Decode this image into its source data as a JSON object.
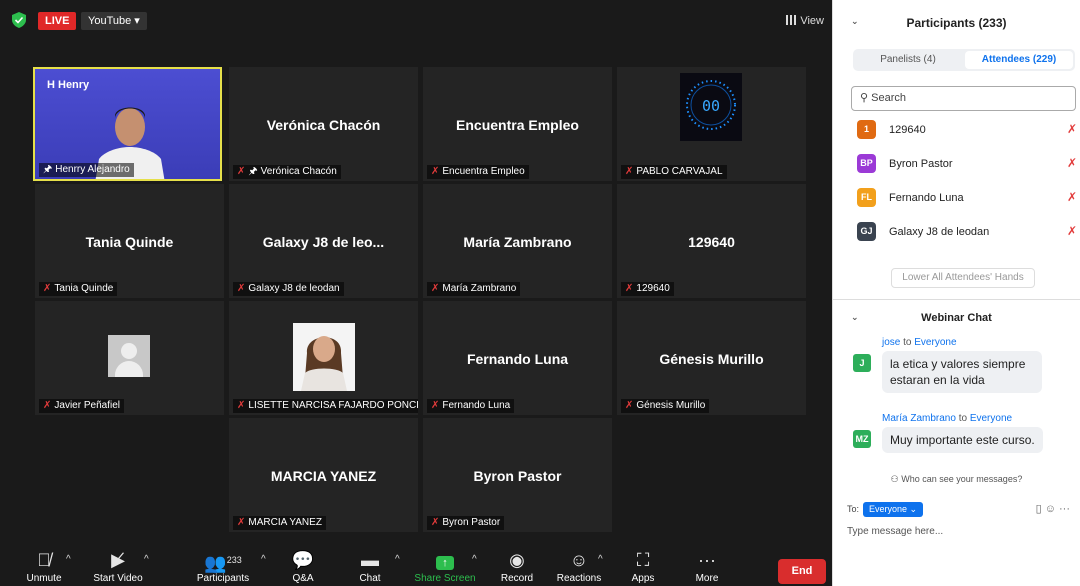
{
  "topbar": {
    "live_label": "LIVE",
    "youtube_label": "YouTube ▾",
    "view_label": "View"
  },
  "tiles": {
    "host_name": "Henrry Alejandro",
    "host_logo": "H Henry",
    "t01_center": "Verónica Chacón",
    "t01_label": "Verónica Chacón",
    "t02_center": "Encuentra Empleo",
    "t02_label": "Encuentra Empleo",
    "t03_label": "PABLO CARVAJAL",
    "t03_clock": "00",
    "t10_center": "Tania Quinde",
    "t10_label": "Tania Quinde",
    "t11_center": "Galaxy J8 de leo...",
    "t11_label": "Galaxy J8 de leodan",
    "t12_center": "María Zambrano",
    "t12_label": "María Zambrano",
    "t13_center": "129640",
    "t13_label": "129640",
    "t20_label": "Javier Peñafiel",
    "t21_label": "LISETTE NARCISA FAJARDO PONCE",
    "t22_center": "Fernando Luna",
    "t22_label": "Fernando Luna",
    "t23_center": "Génesis Murillo",
    "t23_label": "Génesis Murillo",
    "t31_center": "MARCIA YANEZ",
    "t31_label": "MARCIA YANEZ",
    "t32_center": "Byron Pastor",
    "t32_label": "Byron Pastor"
  },
  "toolbar": {
    "unmute": "Unmute",
    "start_video": "Start Video",
    "participants": "Participants",
    "participants_count": "233",
    "qa": "Q&A",
    "chat": "Chat",
    "share_screen": "Share Screen",
    "record": "Record",
    "reactions": "Reactions",
    "apps": "Apps",
    "more": "More",
    "end": "End",
    "share_color": "#2dbe4e",
    "end_color": "#d92d2d"
  },
  "panel": {
    "title": "Participants (233)",
    "tab_panelists": "Panelists (4)",
    "tab_attendees": "Attendees (229)",
    "search_placeholder": "Search",
    "attendees": [
      {
        "initials": "1",
        "name": "129640",
        "color": "#e06a12"
      },
      {
        "initials": "BP",
        "name": "Byron Pastor",
        "color": "#9b3ad6"
      },
      {
        "initials": "FL",
        "name": "Fernando Luna",
        "color": "#f2a01c"
      },
      {
        "initials": "GJ",
        "name": "Galaxy J8 de leodan",
        "color": "#3a4350"
      }
    ],
    "lower_hands": "Lower All Attendees' Hands"
  },
  "chat": {
    "title": "Webinar Chat",
    "messages": [
      {
        "from": "jose",
        "to_word": "to",
        "to": "Everyone",
        "initials": "J",
        "text": "la etica y valores siempre estaran en la vida"
      },
      {
        "from": "María Zambrano",
        "to_word": "to",
        "to": "Everyone",
        "initials": "MZ",
        "text": "Muy importante este curso."
      }
    ],
    "who_can_see": "Who can see your messages?",
    "to_label": "To:",
    "to_value": "Everyone ⌄",
    "input_placeholder": "Type message here..."
  }
}
